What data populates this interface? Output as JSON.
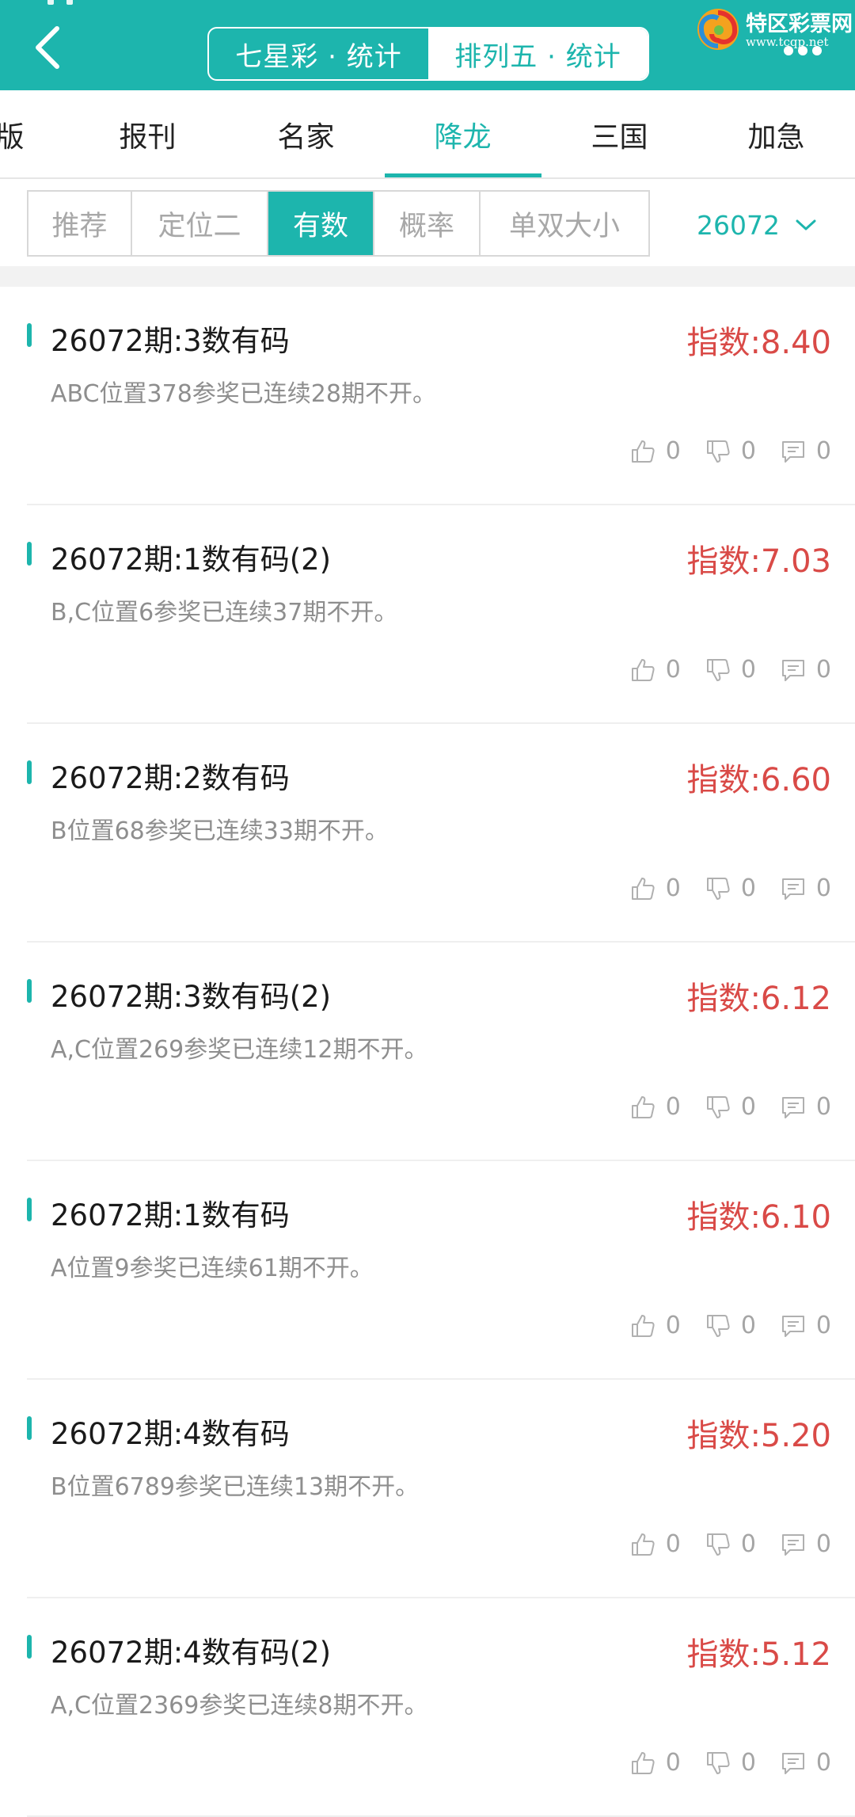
{
  "header": {
    "tabs": [
      {
        "label": "七星彩 · 统计",
        "active": false
      },
      {
        "label": "排列五 · 统计",
        "active": true
      }
    ],
    "brand_name": "特区彩票网",
    "brand_url": "www.tcqp.net",
    "accent_color": "#1db5ad"
  },
  "categories": [
    {
      "label": "版",
      "active": false
    },
    {
      "label": "报刊",
      "active": false
    },
    {
      "label": "名家",
      "active": false
    },
    {
      "label": "降龙",
      "active": true
    },
    {
      "label": "三国",
      "active": false
    },
    {
      "label": "加急",
      "active": false
    }
  ],
  "filters": [
    {
      "label": "推荐",
      "active": false
    },
    {
      "label": "定位二",
      "active": false
    },
    {
      "label": "有数",
      "active": true
    },
    {
      "label": "概率",
      "active": false
    },
    {
      "label": "单双大小",
      "active": false
    }
  ],
  "period": "26072",
  "items": [
    {
      "title": "26072期:3数有码",
      "index": "指数:8.40",
      "desc": "ABC位置378参奖已连续28期不开。",
      "likes": "0",
      "dislikes": "0",
      "comments": "0"
    },
    {
      "title": "26072期:1数有码(2)",
      "index": "指数:7.03",
      "desc": "B,C位置6参奖已连续37期不开。",
      "likes": "0",
      "dislikes": "0",
      "comments": "0"
    },
    {
      "title": "26072期:2数有码",
      "index": "指数:6.60",
      "desc": "B位置68参奖已连续33期不开。",
      "likes": "0",
      "dislikes": "0",
      "comments": "0"
    },
    {
      "title": "26072期:3数有码(2)",
      "index": "指数:6.12",
      "desc": "A,C位置269参奖已连续12期不开。",
      "likes": "0",
      "dislikes": "0",
      "comments": "0"
    },
    {
      "title": "26072期:1数有码",
      "index": "指数:6.10",
      "desc": "A位置9参奖已连续61期不开。",
      "likes": "0",
      "dislikes": "0",
      "comments": "0"
    },
    {
      "title": "26072期:4数有码",
      "index": "指数:5.20",
      "desc": "B位置6789参奖已连续13期不开。",
      "likes": "0",
      "dislikes": "0",
      "comments": "0"
    },
    {
      "title": "26072期:4数有码(2)",
      "index": "指数:5.12",
      "desc": "A,C位置2369参奖已连续8期不开。",
      "likes": "0",
      "dislikes": "0",
      "comments": "0"
    }
  ]
}
